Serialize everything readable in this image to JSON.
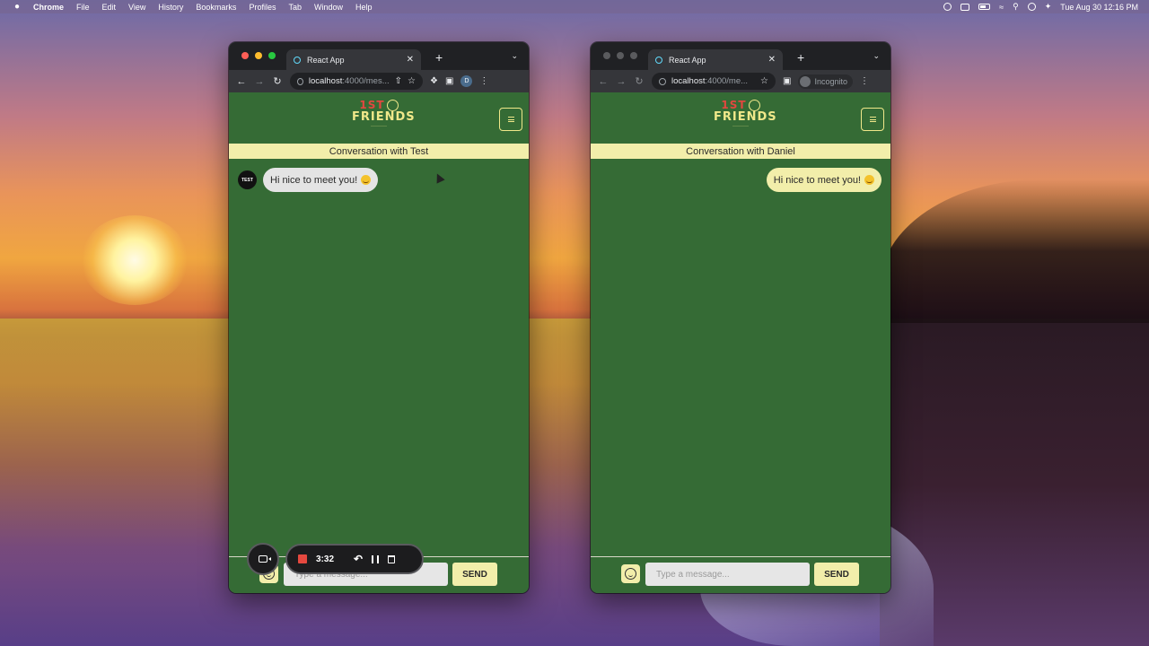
{
  "menubar": {
    "app_name": "Chrome",
    "items": [
      "File",
      "Edit",
      "View",
      "History",
      "Bookmarks",
      "Profiles",
      "Tab",
      "Window",
      "Help"
    ],
    "datetime": "Tue Aug 30  12:16 PM"
  },
  "left_window": {
    "tab_title": "React App",
    "url_host": "localhost",
    "url_rest": ":4000/mes...",
    "profile_initial": "D",
    "conversation_title": "Conversation with Test",
    "message": {
      "avatar_text": "TEST",
      "text": "Hi nice to meet you!",
      "emoji": "smiling-face"
    },
    "input_placeholder": "Type a message...",
    "send_label": "SEND"
  },
  "right_window": {
    "tab_title": "React App",
    "url_host": "localhost",
    "url_rest": ":4000/me...",
    "incognito_label": "Incognito",
    "conversation_title": "Conversation with Daniel",
    "message": {
      "text": "Hi nice to meet you!",
      "emoji": "smiling-face"
    },
    "input_placeholder": "Type a message...",
    "send_label": "SEND"
  },
  "app_logo": {
    "line1": "1ST",
    "line2": "FRIENDS"
  },
  "recorder": {
    "elapsed": "3:32"
  },
  "colors": {
    "app_green": "#356b35",
    "accent_yellow": "#f2eeaa",
    "logo_red": "#e1483f",
    "record_red": "#e5483f"
  }
}
